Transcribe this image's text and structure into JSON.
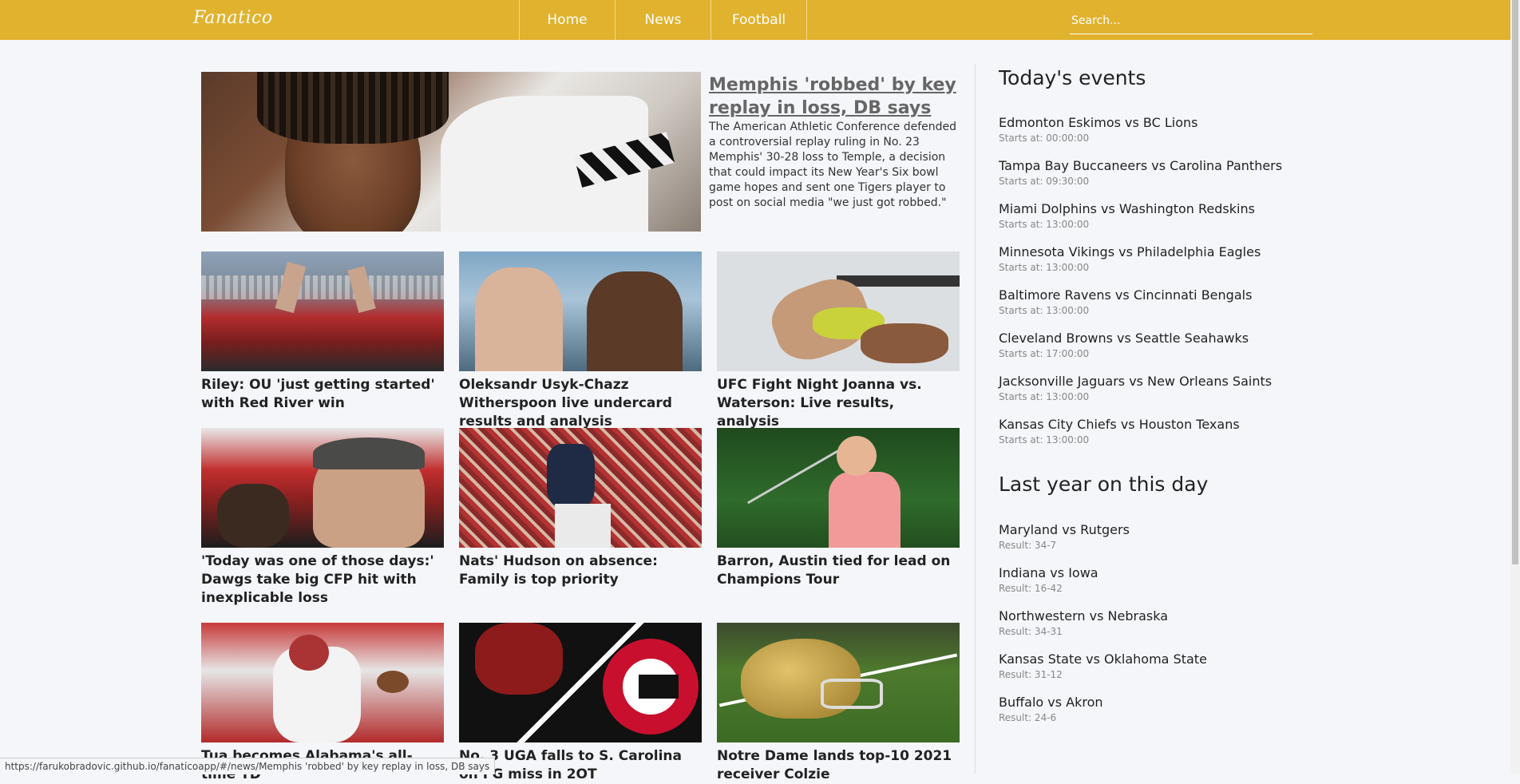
{
  "brand": {
    "logo": "Fanatico",
    "color": "#e0b22e"
  },
  "nav": {
    "items": [
      {
        "label": "Home"
      },
      {
        "label": "News"
      },
      {
        "label": "Football"
      }
    ],
    "search_placeholder": "Search..."
  },
  "featured": {
    "title": "Memphis 'robbed' by key replay in loss, DB says",
    "description": "The American Athletic Conference defended a controversial replay ruling in No. 23 Memphis' 30-28 loss to Temple, a decision that could impact its New Year's Six bowl game hopes and sent one Tigers player to post on social media \"we just got robbed.\""
  },
  "articles": [
    {
      "title": "Riley: OU 'just getting started' with Red River win"
    },
    {
      "title": "Oleksandr Usyk-Chazz Witherspoon live undercard results and analysis"
    },
    {
      "title": "UFC Fight Night Joanna vs. Waterson: Live results, analysis"
    },
    {
      "title": "'Today was one of those days:' Dawgs take big CFP hit with inexplicable loss"
    },
    {
      "title": "Nats' Hudson on absence: Family is top priority"
    },
    {
      "title": "Barron, Austin tied for lead on Champions Tour"
    },
    {
      "title": "Tua becomes Alabama's all-time TD"
    },
    {
      "title": "No. 3 UGA falls to S. Carolina on FG miss in 2OT"
    },
    {
      "title": "Notre Dame lands top-10 2021 receiver Colzie"
    }
  ],
  "todays_events": {
    "heading": "Today's events",
    "items": [
      {
        "name": "Edmonton Eskimos vs BC Lions",
        "starts": "Starts at: 00:00:00"
      },
      {
        "name": "Tampa Bay Buccaneers vs Carolina Panthers",
        "starts": "Starts at: 09:30:00"
      },
      {
        "name": "Miami Dolphins vs Washington Redskins",
        "starts": "Starts at: 13:00:00"
      },
      {
        "name": "Minnesota Vikings vs Philadelphia Eagles",
        "starts": "Starts at: 13:00:00"
      },
      {
        "name": "Baltimore Ravens vs Cincinnati Bengals",
        "starts": "Starts at: 13:00:00"
      },
      {
        "name": "Cleveland Browns vs Seattle Seahawks",
        "starts": "Starts at: 17:00:00"
      },
      {
        "name": "Jacksonville Jaguars vs New Orleans Saints",
        "starts": "Starts at: 13:00:00"
      },
      {
        "name": "Kansas City Chiefs vs Houston Texans",
        "starts": "Starts at: 13:00:00"
      }
    ]
  },
  "last_year": {
    "heading": "Last year on this day",
    "items": [
      {
        "name": "Maryland vs Rutgers",
        "result": "Result: 34-7"
      },
      {
        "name": "Indiana vs Iowa",
        "result": "Result: 16-42"
      },
      {
        "name": "Northwestern vs Nebraska",
        "result": "Result: 34-31"
      },
      {
        "name": "Kansas State vs Oklahoma State",
        "result": "Result: 31-12"
      },
      {
        "name": "Buffalo vs Akron",
        "result": "Result: 24-6"
      }
    ]
  },
  "status_bar": {
    "url": "https://farukobradovic.github.io/fanaticoapp/#/news/Memphis 'robbed' by key replay in loss, DB says"
  }
}
